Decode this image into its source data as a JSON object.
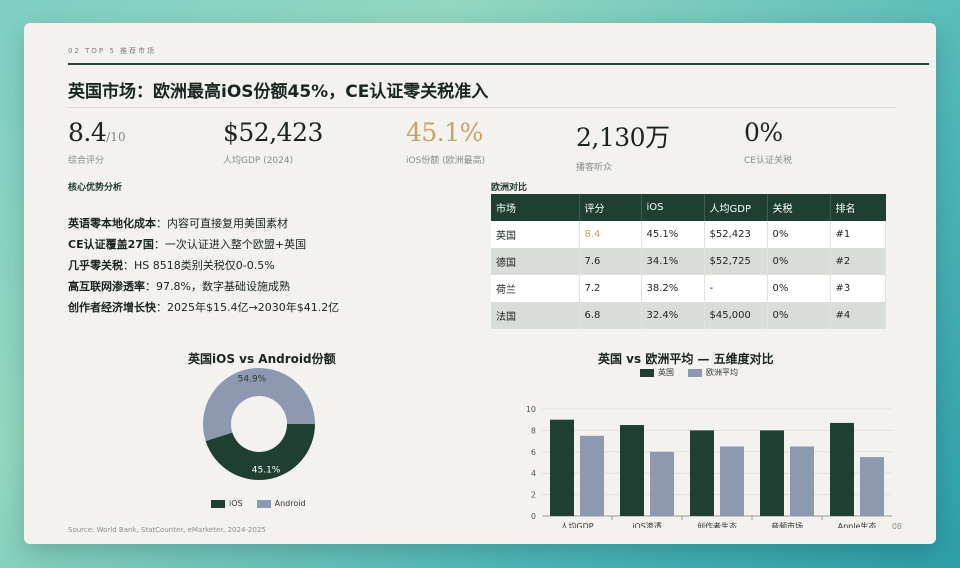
{
  "header": {
    "kicker": "02 TOP 5 推荐市场",
    "title": "英国市场：欧洲最高iOS份额45%，CE认证零关税准入"
  },
  "kpis": [
    {
      "value": "8.4",
      "suffix": "/10",
      "label": "综合评分"
    },
    {
      "value": "$52,423",
      "label": "人均GDP (2024)"
    },
    {
      "value": "45.1%",
      "label": "iOS份额 (欧洲最高)",
      "accent": "#c6a365"
    },
    {
      "value": "2,130万",
      "label": "播客听众"
    },
    {
      "value": "0%",
      "label": "CE认证关税"
    }
  ],
  "advantages": {
    "heading": "核心优势分析",
    "items": [
      {
        "key": "英语零本地化成本",
        "sep": "：",
        "text": "内容可直接复用美国素材"
      },
      {
        "key": "CE认证覆盖27国",
        "sep": "：",
        "text": "一次认证进入整个欧盟+英国"
      },
      {
        "key": "几乎零关税",
        "sep": "：",
        "text": "HS 8518类别关税仅0-0.5%"
      },
      {
        "key": "高互联网渗透率",
        "sep": "：",
        "text": "97.8%，数字基础设施成熟"
      },
      {
        "key": "创作者经济增长快",
        "sep": "：",
        "text": "2025年$15.4亿→2030年$41.2亿"
      }
    ]
  },
  "comparison": {
    "heading": "欧洲对比",
    "columns": [
      "市场",
      "评分",
      "iOS",
      "人均GDP",
      "关税",
      "排名"
    ],
    "rows": [
      [
        "英国",
        "8.4",
        "45.1%",
        "$52,423",
        "0%",
        "#1"
      ],
      [
        "德国",
        "7.6",
        "34.1%",
        "$52,725",
        "0%",
        "#2"
      ],
      [
        "荷兰",
        "7.2",
        "38.2%",
        "-",
        "0%",
        "#3"
      ],
      [
        "法国",
        "6.8",
        "32.4%",
        "$45,000",
        "0%",
        "#4"
      ]
    ]
  },
  "colors": {
    "dark_green": "#1e3f31",
    "slate": "#8d99b0",
    "gold": "#c6a365"
  },
  "chart_data": [
    {
      "type": "pie",
      "title": "英国iOS vs Android份额",
      "labels": [
        "iOS",
        "Android"
      ],
      "values": [
        45.1,
        54.9
      ],
      "value_labels": [
        "45.1%",
        "54.9%"
      ],
      "colors": [
        "#1e3f31",
        "#8d99b0"
      ],
      "donut": true,
      "legend": "bottom"
    },
    {
      "type": "bar",
      "title": "英国 vs 欧洲平均 — 五维度对比",
      "categories": [
        "人均GDP",
        "iOS渗透",
        "创作者生态",
        "音频市场",
        "Apple生态"
      ],
      "series": [
        {
          "name": "英国",
          "values": [
            9,
            8.5,
            8,
            8,
            8.7
          ],
          "color": "#1e3f31"
        },
        {
          "name": "欧洲平均",
          "values": [
            7.5,
            6,
            6.5,
            6.5,
            5.5
          ],
          "color": "#8d99b0"
        }
      ],
      "ylim": [
        0,
        10
      ],
      "yticks": [
        0,
        2,
        4,
        6,
        8,
        10
      ],
      "grid": true,
      "legend": "top"
    }
  ],
  "footer": {
    "source": "Source: World Bank, StatCounter, eMarketer, 2024-2025",
    "page": "08"
  }
}
